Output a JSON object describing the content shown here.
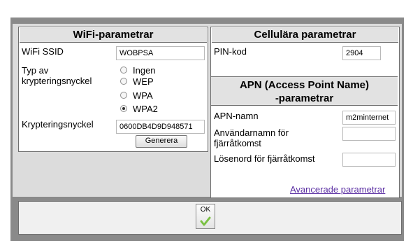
{
  "wifi": {
    "title": "WiFi-parametrar",
    "ssid_label": "WiFi SSID",
    "ssid_value": "WOBPSA",
    "encryption_type_label_line1": "Typ av",
    "encryption_type_label_line2": "krypteringsnyckel",
    "encryption_options": [
      "Ingen",
      "WEP",
      "WPA",
      "WPA2"
    ],
    "encryption_selected": "WPA2",
    "key_label": "Krypteringsnyckel",
    "key_value": "0600DB4D9D948571",
    "generate_label": "Generera"
  },
  "cellular": {
    "title": "Cellulära parametrar",
    "pin_label": "PIN-kod",
    "pin_value": "2904",
    "apn_title_line1": "APN (Access Point Name)",
    "apn_title_line2": "-parametrar",
    "apn_name_label": "APN-namn",
    "apn_name_value": "m2minternet",
    "remote_user_label_line1": "Användarnamn för",
    "remote_user_label_line2": "fjärråtkomst",
    "remote_user_value": "",
    "remote_password_label": "Lösenord för fjärråtkomst",
    "remote_password_value": "",
    "advanced_link": "Avancerade parametrar"
  },
  "footer": {
    "ok_label": "OK"
  },
  "colors": {
    "checkmark": "#7ac143",
    "link": "#5b2fa3"
  }
}
